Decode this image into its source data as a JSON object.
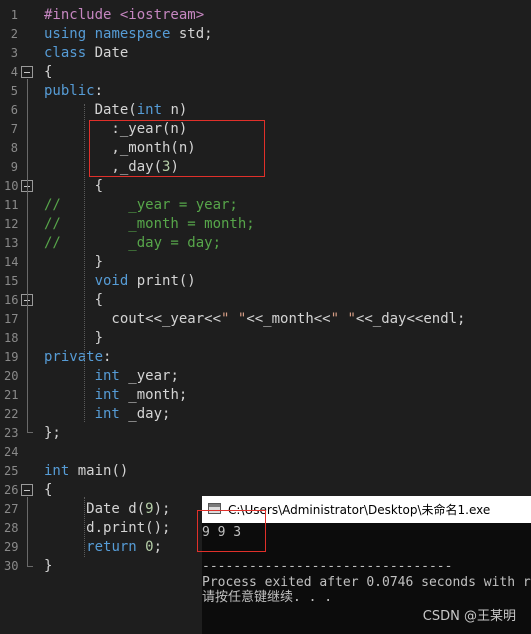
{
  "editor": {
    "lines": [
      {
        "n": "1",
        "tokens": [
          [
            "pp",
            "#include <iostream>"
          ]
        ]
      },
      {
        "n": "2",
        "tokens": [
          [
            "kw",
            "using"
          ],
          [
            "pl",
            " "
          ],
          [
            "kw",
            "namespace"
          ],
          [
            "pl",
            " std;"
          ]
        ]
      },
      {
        "n": "3",
        "tokens": [
          [
            "kw",
            "class"
          ],
          [
            "pl",
            " Date"
          ]
        ]
      },
      {
        "n": "4",
        "tokens": [
          [
            "pl",
            "{"
          ]
        ]
      },
      {
        "n": "5",
        "tokens": [
          [
            "kw",
            "public"
          ],
          [
            "pl",
            ":"
          ]
        ]
      },
      {
        "n": "6",
        "tokens": [
          [
            "pl",
            "      Date("
          ],
          [
            "kw",
            "int"
          ],
          [
            "pl",
            " n)"
          ]
        ]
      },
      {
        "n": "7",
        "tokens": [
          [
            "pl",
            "        :_year(n)"
          ]
        ]
      },
      {
        "n": "8",
        "tokens": [
          [
            "pl",
            "        ,_month(n)"
          ]
        ]
      },
      {
        "n": "9",
        "tokens": [
          [
            "pl",
            "        ,_day("
          ],
          [
            "nm",
            "3"
          ],
          [
            "pl",
            ")"
          ]
        ]
      },
      {
        "n": "10",
        "tokens": [
          [
            "pl",
            "      {"
          ]
        ]
      },
      {
        "n": "11",
        "tokens": [
          [
            "cm",
            "//        _year = year;"
          ]
        ]
      },
      {
        "n": "12",
        "tokens": [
          [
            "cm",
            "//        _month = month;"
          ]
        ]
      },
      {
        "n": "13",
        "tokens": [
          [
            "cm",
            "//        _day = day;"
          ]
        ]
      },
      {
        "n": "14",
        "tokens": [
          [
            "pl",
            "      }"
          ]
        ]
      },
      {
        "n": "15",
        "tokens": [
          [
            "pl",
            "      "
          ],
          [
            "kw",
            "void"
          ],
          [
            "pl",
            " print()"
          ]
        ]
      },
      {
        "n": "16",
        "tokens": [
          [
            "pl",
            "      {"
          ]
        ]
      },
      {
        "n": "17",
        "tokens": [
          [
            "pl",
            "        cout<<_year<<"
          ],
          [
            "st",
            "\" \""
          ],
          [
            "pl",
            "<<_month<<"
          ],
          [
            "st",
            "\" \""
          ],
          [
            "pl",
            "<<_day<<endl;"
          ]
        ]
      },
      {
        "n": "18",
        "tokens": [
          [
            "pl",
            "      }"
          ]
        ]
      },
      {
        "n": "19",
        "tokens": [
          [
            "kw",
            "private"
          ],
          [
            "pl",
            ":"
          ]
        ]
      },
      {
        "n": "20",
        "tokens": [
          [
            "pl",
            "      "
          ],
          [
            "kw",
            "int"
          ],
          [
            "pl",
            " _year;"
          ]
        ]
      },
      {
        "n": "21",
        "tokens": [
          [
            "pl",
            "      "
          ],
          [
            "kw",
            "int"
          ],
          [
            "pl",
            " _month;"
          ]
        ]
      },
      {
        "n": "22",
        "tokens": [
          [
            "pl",
            "      "
          ],
          [
            "kw",
            "int"
          ],
          [
            "pl",
            " _day;"
          ]
        ]
      },
      {
        "n": "23",
        "tokens": [
          [
            "pl",
            "};"
          ]
        ]
      },
      {
        "n": "24",
        "tokens": []
      },
      {
        "n": "25",
        "tokens": [
          [
            "kw",
            "int"
          ],
          [
            "pl",
            " main()"
          ]
        ]
      },
      {
        "n": "26",
        "tokens": [
          [
            "pl",
            "{"
          ]
        ]
      },
      {
        "n": "27",
        "tokens": [
          [
            "pl",
            "     Date d("
          ],
          [
            "nm",
            "9"
          ],
          [
            "pl",
            ");"
          ]
        ]
      },
      {
        "n": "28",
        "tokens": [
          [
            "pl",
            "     d.print();"
          ]
        ]
      },
      {
        "n": "29",
        "tokens": [
          [
            "pl",
            "     "
          ],
          [
            "kw",
            "return"
          ],
          [
            "pl",
            " "
          ],
          [
            "nm",
            "0"
          ],
          [
            "pl",
            ";"
          ]
        ]
      },
      {
        "n": "30",
        "tokens": [
          [
            "pl",
            "}"
          ]
        ]
      }
    ],
    "fold_lines": [
      "4",
      "10",
      "16",
      "26"
    ]
  },
  "console": {
    "title": "C:\\Users\\Administrator\\Desktop\\未命名1.exe",
    "output": "9 9 3",
    "separator": "--------------------------------",
    "process_msg": "Process exited after 0.0746 seconds with r",
    "continue_msg": "请按任意键继续. . ."
  },
  "watermark": "CSDN @王某明",
  "colors": {
    "background": "#1e1e1e",
    "keyword": "#569cd6",
    "preprocessor": "#c586c0",
    "comment": "#57a64a",
    "number": "#b5cea8",
    "string": "#d69d85",
    "highlight_box": "#e0302a"
  }
}
